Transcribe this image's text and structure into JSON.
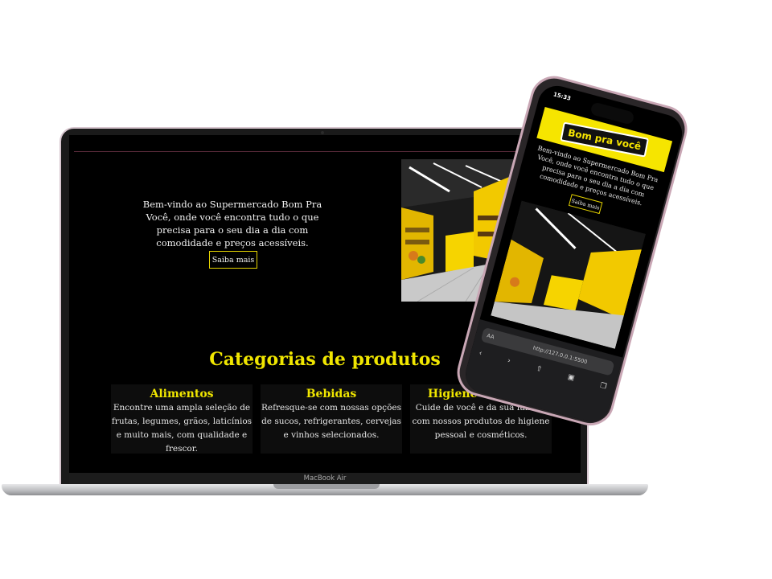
{
  "laptop": {
    "hero": {
      "text": "Bem-vindo ao Supermercado Bom Pra Você, onde você encontra tudo o que precisa para o seu dia a dia com comodidade e preços acessíveis.",
      "button": "Saiba mais"
    },
    "categories_title": "Categorias de produtos",
    "categories": [
      {
        "title": "Alimentos",
        "text": "Encontre uma ampla seleção de frutas, legumes, grãos, laticínios e muito mais, com qualidade e frescor."
      },
      {
        "title": "Bebidas",
        "text": "Refresque-se com nossas opções de sucos, refrigerantes, cervejas e vinhos selecionados."
      },
      {
        "title": "Higiene e Beleza",
        "text": "Cuide de você e da sua família com nossos produtos de higiene pessoal e cosméticos."
      }
    ],
    "model_label": "MacBook Air"
  },
  "phone": {
    "time": "15:33",
    "logo": "Bom pra você",
    "hero_text": "Bem-vindo ao Supermercado Bom Pra Você, onde você encontra tudo o que precisa para o seu dia a dia com comodidade e preços acessíveis.",
    "button": "Saiba mais",
    "url_aa": "AA",
    "url": "http://127.0.0.1:5500",
    "toolbar_icons": [
      "back-icon",
      "forward-icon",
      "share-icon",
      "bookmarks-icon",
      "tabs-icon"
    ]
  },
  "colors": {
    "accent": "#f0e600",
    "background": "#000000"
  }
}
